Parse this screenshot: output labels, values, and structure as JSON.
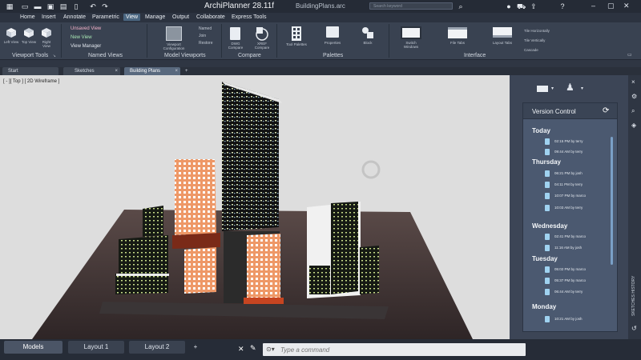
{
  "app": {
    "title": "ArchiPlanner 28.11f",
    "filename": "BuildingPlans.arc",
    "search_placeholder": "Search keyword"
  },
  "menu": [
    "Home",
    "Insert",
    "Annotate",
    "Parametric",
    "View",
    "Manage",
    "Output",
    "Collaborate",
    "Express Tools"
  ],
  "menu_active": "View",
  "ribbon": {
    "viewport_tools": {
      "label": "Viewport Tools",
      "buttons": [
        "Left View",
        "Top View",
        "Right View"
      ]
    },
    "named_views": {
      "label": "Named Views",
      "items": [
        "Unsaved View",
        "New View",
        "View Manager"
      ]
    },
    "model_viewports": {
      "label": "Model Viewports",
      "big": "Viewport Configuration",
      "items": [
        "Named",
        "Join",
        "Restore"
      ]
    },
    "compare": {
      "label": "Compare",
      "buttons": [
        "DWG Compare",
        "XREF Compare"
      ]
    },
    "palettes": {
      "label": "Palettes",
      "buttons": [
        "Tool Palettes",
        "Properties",
        "Block"
      ]
    },
    "interface": {
      "label": "Interface",
      "buttons": [
        "Switch Windows",
        "File Tabs",
        "Layout Tabs"
      ],
      "items": [
        "Tile Horizontally",
        "Tile Vertically",
        "Cascade"
      ]
    }
  },
  "tabs": [
    {
      "label": "Start"
    },
    {
      "label": "Sketches"
    },
    {
      "label": "Building Plans"
    }
  ],
  "viewport": {
    "label": "[ - ][ Top ] [ 2D Wireframe ]"
  },
  "version_control": {
    "title": "Version Control",
    "groups": [
      {
        "day": "Today",
        "entries": [
          "02:15 PM by terry",
          "09:44 AM by terry"
        ]
      },
      {
        "day": "Thursday",
        "entries": [
          "06:21 PM by josh",
          "04:11 PM by terry",
          "10:07 PM by marco",
          "10:03 AM by terry"
        ]
      },
      {
        "day": "Wednesday",
        "entries": [
          "02:41 PM by marco",
          "11:16 AM by josh"
        ]
      },
      {
        "day": "Tuesday",
        "entries": [
          "05:02 PM by marco",
          "05:37 PM by marco",
          "06:44 AM by terry"
        ]
      },
      {
        "day": "Monday",
        "entries": [
          "10:21 AM by josh"
        ]
      }
    ]
  },
  "side_tab": "SKETCHES HISTORY",
  "bottom": {
    "tabs": [
      "Models",
      "Layout 1",
      "Layout 2"
    ],
    "command_placeholder": "Type a command"
  },
  "colors": {
    "accent": "#4a6681",
    "panel": "#3c4556",
    "doc_icon": "#9fd2f0"
  }
}
